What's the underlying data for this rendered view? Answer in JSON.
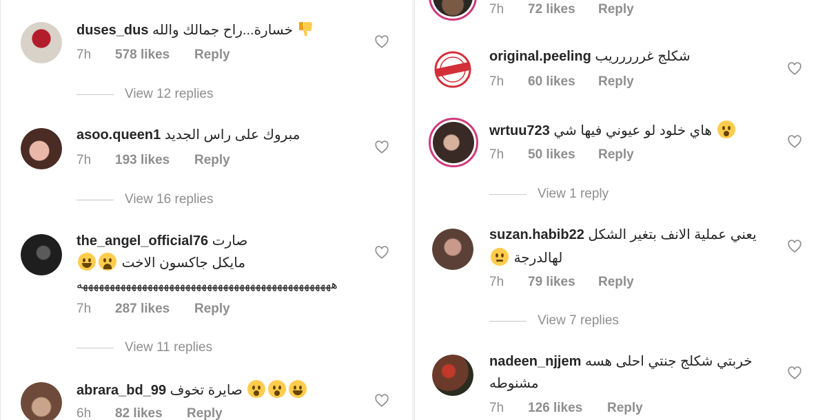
{
  "left": {
    "comments": [
      {
        "username": "duses_dus",
        "text": "خسارة...راح جمالك والله",
        "time": "7h",
        "likes": "578 likes",
        "reply": "Reply",
        "replies": "View 12 replies"
      },
      {
        "username": "asoo.queen1",
        "text": "مبروك على راس الجديد",
        "time": "7h",
        "likes": "193 likes",
        "reply": "Reply",
        "replies": "View 16 replies"
      },
      {
        "username": "the_angel_official76",
        "text": "صارت",
        "text2": "مايكل جاكسون الاخت",
        "text3": "هههههههههههههههههههههههههههههههههههههههههههههههه",
        "time": "7h",
        "likes": "287 likes",
        "reply": "Reply",
        "replies": "View 11 replies"
      },
      {
        "username": "abrara_bd_99",
        "text": "صايرة تخوف",
        "time": "6h",
        "likes": "82 likes",
        "reply": "Reply"
      }
    ]
  },
  "right": {
    "comments": [
      {
        "time": "7h",
        "likes": "72 likes",
        "reply": "Reply"
      },
      {
        "username": "original.peeling",
        "text": "شكلج غررررريب",
        "time": "7h",
        "likes": "60 likes",
        "reply": "Reply"
      },
      {
        "username": "wrtuu723",
        "text": "هاي خلود لو عيوني فيها شي",
        "time": "7h",
        "likes": "50 likes",
        "reply": "Reply",
        "replies": "View 1 reply"
      },
      {
        "username": "suzan.habib22",
        "text": "يعني عملية الانف بتغير الشكل",
        "text2": "لهالدرجة",
        "time": "7h",
        "likes": "79 likes",
        "reply": "Reply",
        "replies": "View 7 replies"
      },
      {
        "username": "nadeen_njjem",
        "text": "خربتي شكلج جنتي احلى هسه",
        "text2": "مشنوطه",
        "time": "7h",
        "likes": "126 likes",
        "reply": "Reply"
      }
    ]
  },
  "colors": {
    "text": "#262626",
    "meta": "#8e8e8e",
    "story_ring": "#d03a7b",
    "emoji": "#ffcc4d"
  }
}
